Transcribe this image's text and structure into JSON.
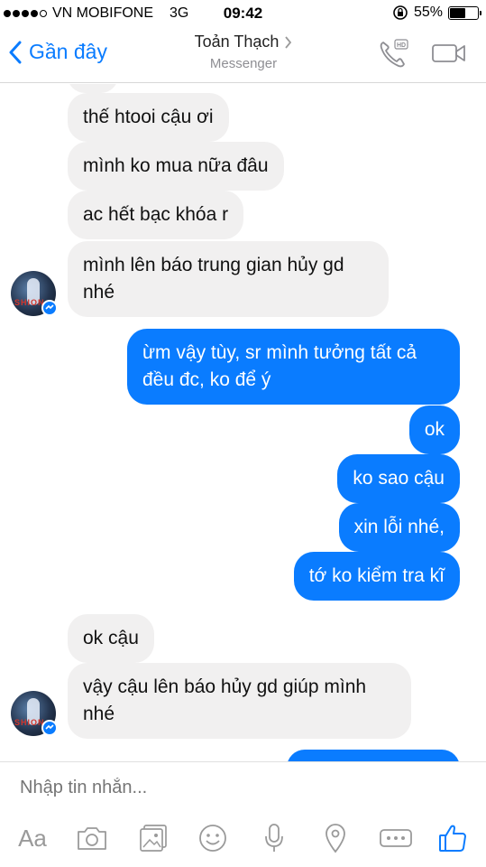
{
  "status": {
    "carrier": "VN MOBIFONE",
    "network": "3G",
    "time": "09:42",
    "battery": "55%",
    "battery_level": 0.55
  },
  "header": {
    "back_label": "Gần đây",
    "contact_name": "Toản Thạch",
    "subtitle": "Messenger",
    "call_icon": "phone-hd-icon",
    "video_icon": "video-camera-icon"
  },
  "messages": [
    {
      "from": "them",
      "text": "thế htooi cậu ơi"
    },
    {
      "from": "them",
      "text": "mình ko mua nữa đâu"
    },
    {
      "from": "them",
      "text": "ac hết bạc khóa r"
    },
    {
      "from": "them",
      "line1": "mình lên báo trung gian hủy gd",
      "line2": "nhé"
    },
    {
      "from": "me",
      "line1": "ừm vậy tùy, sr mình tưởng tất cả",
      "line2": "đều đc, ko để ý"
    },
    {
      "from": "me",
      "text": "ok"
    },
    {
      "from": "me",
      "text": "ko sao cậu"
    },
    {
      "from": "me",
      "text": "xin lỗi nhé,"
    },
    {
      "from": "me",
      "text": "tớ ko kiểm tra kĩ"
    },
    {
      "from": "them",
      "text": "ok cậu"
    },
    {
      "from": "them",
      "line1": "vậy cậu lên báo hủy gd giúp mình",
      "line2": "nhé"
    }
  ],
  "composer": {
    "placeholder": "Nhập tin nhắn...",
    "aa_label": "Aa",
    "tools": [
      "text-format-icon",
      "camera-icon",
      "gallery-icon",
      "emoji-icon",
      "microphone-icon",
      "location-icon",
      "more-icon",
      "like-icon"
    ]
  },
  "colors": {
    "accent": "#0a7cff",
    "incoming_bubble": "#f1f0f0",
    "outgoing_text": "#ffffff"
  }
}
